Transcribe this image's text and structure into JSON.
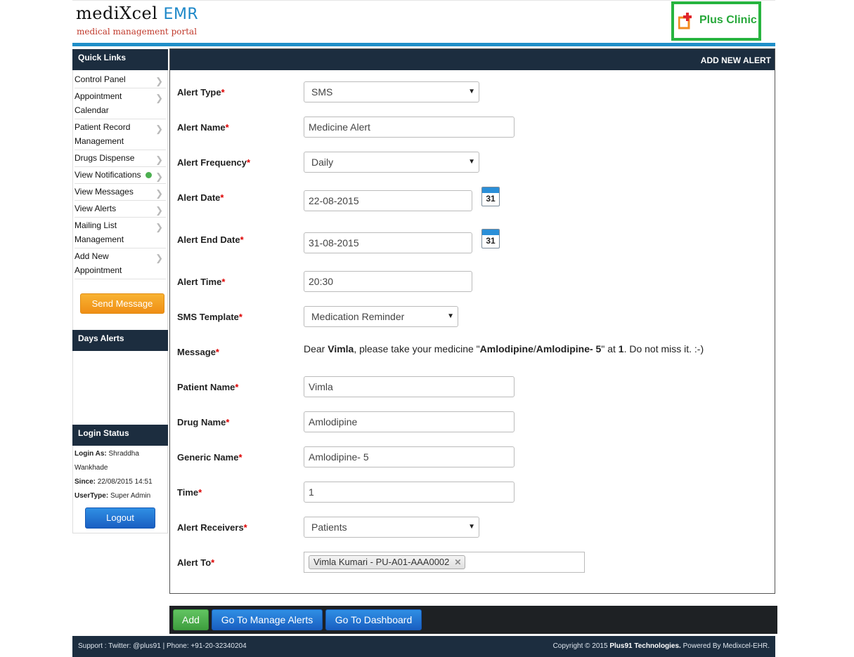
{
  "header": {
    "logo_main": "mediXcel",
    "logo_emr": "EMR",
    "logo_sub": "medical management portal",
    "clinic_name": "Plus Clinic"
  },
  "sidebar": {
    "quick_links_title": "Quick Links",
    "links": [
      {
        "label": "Control Panel"
      },
      {
        "label": "Appointment Calendar"
      },
      {
        "label": "Patient Record Management"
      },
      {
        "label": "Drugs Dispense"
      },
      {
        "label": "View Notifications"
      },
      {
        "label": "View Messages"
      },
      {
        "label": "View Alerts"
      },
      {
        "label": "Mailing List Management"
      },
      {
        "label": "Add New Appointment"
      }
    ],
    "send_message_label": "Send Message",
    "days_alerts_title": "Days Alerts",
    "login_status_title": "Login Status",
    "login_as_label": "Login As:",
    "login_as_value": "Shraddha Wankhade",
    "since_label": "Since:",
    "since_value": "22/08/2015 14:51",
    "usertype_label": "UserType:",
    "usertype_value": "Super Admin",
    "logout_label": "Logout"
  },
  "form": {
    "title": "ADD NEW ALERT",
    "required_mark": "*",
    "alert_type": {
      "label": "Alert Type",
      "value": "SMS"
    },
    "alert_name": {
      "label": "Alert Name",
      "value": "Medicine Alert"
    },
    "alert_frequency": {
      "label": "Alert Frequency",
      "value": "Daily"
    },
    "alert_date": {
      "label": "Alert Date",
      "value": "22-08-2015"
    },
    "alert_end_date": {
      "label": "Alert End Date",
      "value": "31-08-2015"
    },
    "calendar_day": "31",
    "alert_time": {
      "label": "Alert Time",
      "value": "20:30"
    },
    "sms_template": {
      "label": "SMS Template",
      "value": "Medication Reminder"
    },
    "message": {
      "label": "Message",
      "p1": "Dear ",
      "name": "Vimla",
      "p2": ", please take your medicine \"",
      "drug": "Amlodipine",
      "sep": "/",
      "generic": "Amlodipine- 5",
      "p3": "\" at ",
      "time": "1",
      "p4": ". Do not miss it. :-)"
    },
    "patient_name": {
      "label": "Patient Name",
      "value": "Vimla"
    },
    "drug_name": {
      "label": "Drug Name",
      "value": "Amlodipine"
    },
    "generic_name": {
      "label": "Generic Name",
      "value": "Amlodipine- 5"
    },
    "time": {
      "label": "Time",
      "value": "1"
    },
    "alert_receivers": {
      "label": "Alert Receivers",
      "value": "Patients"
    },
    "alert_to": {
      "label": "Alert To",
      "tag": "Vimla Kumari - PU-A01-AAA0002"
    }
  },
  "actions": {
    "add_label": "Add",
    "manage_label": "Go To Manage Alerts",
    "dashboard_label": "Go To Dashboard"
  },
  "footer": {
    "left": "Support : Twitter: @plus91 | Phone: +91-20-32340204",
    "copyright": "Copyright © 2015 ",
    "company": "Plus91 Technologies.",
    "powered": "  Powered By Medixcel-EHR."
  }
}
